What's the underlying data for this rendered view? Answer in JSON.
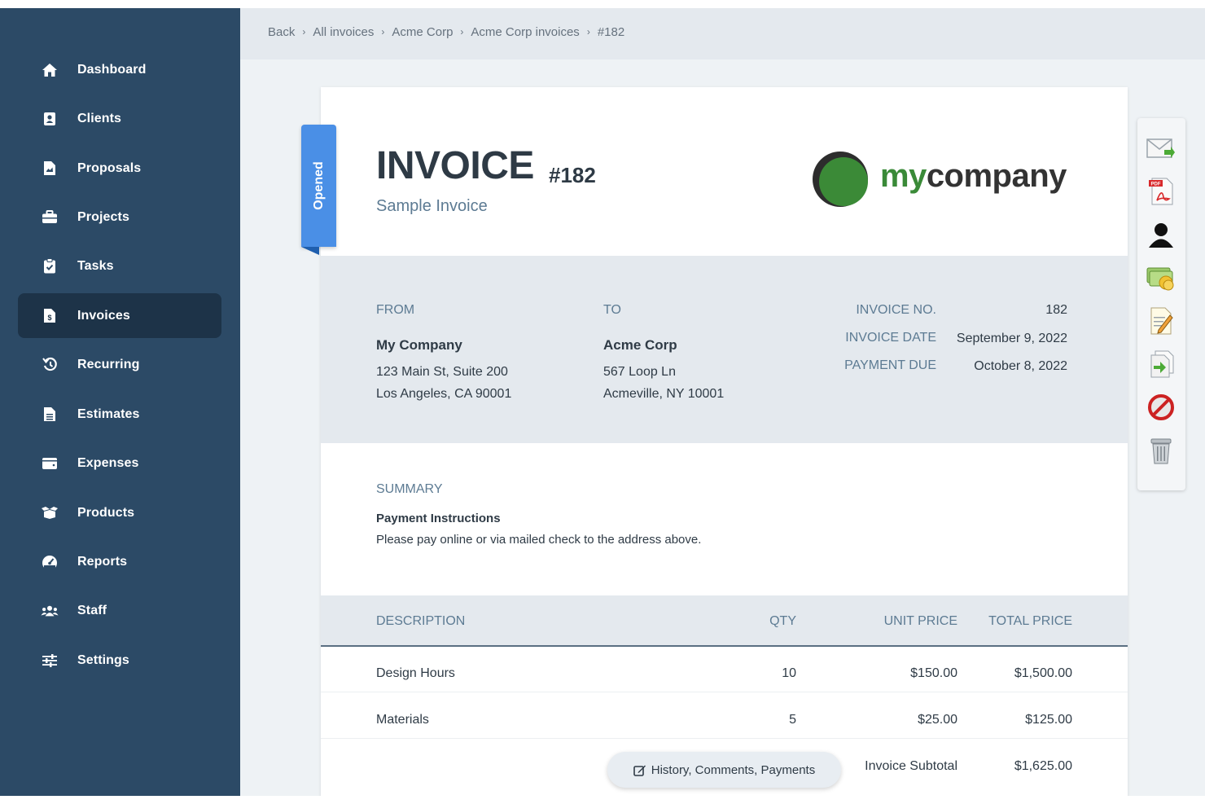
{
  "sidebar": {
    "items": [
      {
        "label": "Dashboard",
        "icon": "home-icon"
      },
      {
        "label": "Clients",
        "icon": "contact-card-icon"
      },
      {
        "label": "Proposals",
        "icon": "document-icon"
      },
      {
        "label": "Projects",
        "icon": "briefcase-icon"
      },
      {
        "label": "Tasks",
        "icon": "clipboard-check-icon"
      },
      {
        "label": "Invoices",
        "icon": "invoice-dollar-icon",
        "active": true
      },
      {
        "label": "Recurring",
        "icon": "history-icon"
      },
      {
        "label": "Estimates",
        "icon": "file-lines-icon"
      },
      {
        "label": "Expenses",
        "icon": "wallet-icon"
      },
      {
        "label": "Products",
        "icon": "box-open-icon"
      },
      {
        "label": "Reports",
        "icon": "gauge-icon"
      },
      {
        "label": "Staff",
        "icon": "users-icon"
      },
      {
        "label": "Settings",
        "icon": "sliders-icon"
      }
    ]
  },
  "breadcrumb": {
    "items": [
      "Back",
      "All invoices",
      "Acme Corp",
      "Acme Corp invoices",
      "#182"
    ],
    "separator": "›"
  },
  "status_ribbon": {
    "label": "Opened",
    "color": "#4a8fe6"
  },
  "invoice": {
    "title": "INVOICE",
    "number": "#182",
    "subtitle": "Sample Invoice"
  },
  "logo": {
    "text_my": "my",
    "text_company": "company",
    "brand_color": "#3a8a38"
  },
  "from": {
    "label": "FROM",
    "name": "My Company",
    "address1": "123 Main St, Suite 200",
    "address2": "Los Angeles, CA 90001"
  },
  "to": {
    "label": "TO",
    "name": "Acme Corp",
    "address1": "567 Loop Ln",
    "address2": "Acmeville, NY 10001"
  },
  "meta": {
    "invoice_no_label": "INVOICE NO.",
    "invoice_no": "182",
    "invoice_date_label": "INVOICE DATE",
    "invoice_date": "September 9, 2022",
    "payment_due_label": "PAYMENT DUE",
    "payment_due": "October 8, 2022"
  },
  "summary": {
    "title": "SUMMARY",
    "instructions_title": "Payment Instructions",
    "instructions_text": "Please pay online or via mailed check to the address above."
  },
  "table": {
    "headers": {
      "description": "DESCRIPTION",
      "qty": "QTY",
      "unit_price": "UNIT PRICE",
      "total_price": "TOTAL PRICE"
    },
    "rows": [
      {
        "description": "Design Hours",
        "qty": "10",
        "unit_price": "$150.00",
        "total_price": "$1,500.00"
      },
      {
        "description": "Materials",
        "qty": "5",
        "unit_price": "$25.00",
        "total_price": "$125.00"
      }
    ],
    "subtotal_label": "Invoice Subtotal",
    "subtotal": "$1,625.00"
  },
  "history_button": {
    "label": "History, Comments, Payments",
    "icon": "edit-icon"
  },
  "tools": [
    "email-icon",
    "pdf-icon",
    "client-icon",
    "payment-icon",
    "edit-document-icon",
    "export-icon",
    "cancel-icon",
    "trash-icon"
  ],
  "colors": {
    "sidebar_bg": "#2c4a66",
    "sidebar_active": "#1d3348",
    "accent_label": "#5d7b93",
    "band_bg": "#e4e9ee"
  }
}
